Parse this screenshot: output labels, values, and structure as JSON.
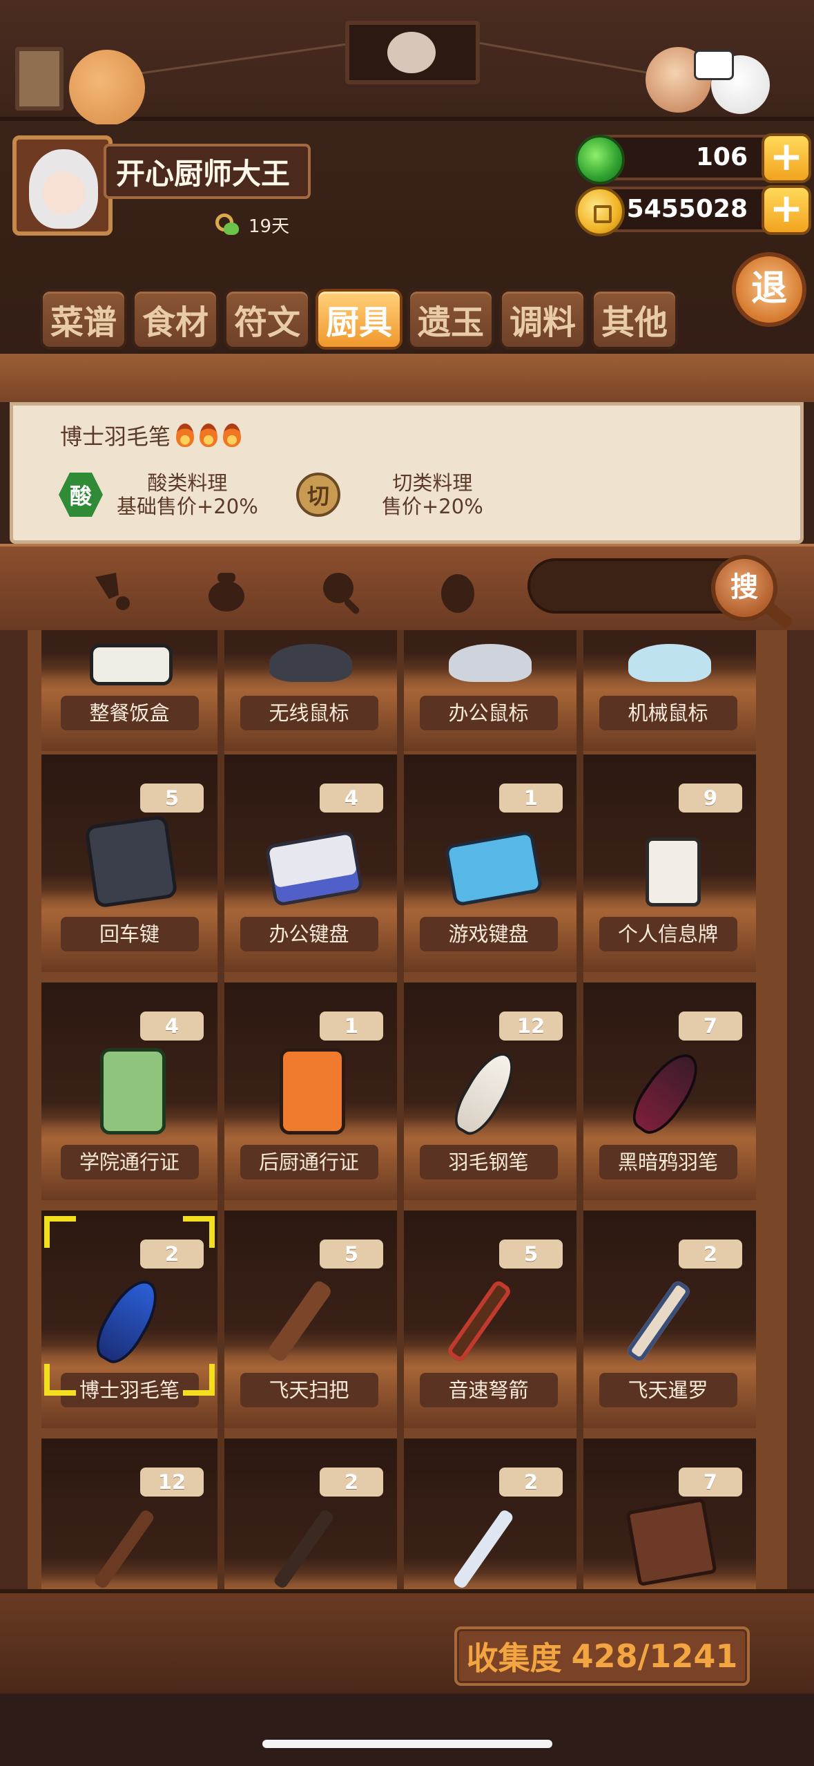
{
  "profile": {
    "name": "开心厨师大王",
    "days": "19天"
  },
  "currency": {
    "jade": "106",
    "coins": "5455028",
    "plus": "+"
  },
  "exit_label": "退",
  "tabs": [
    {
      "label": "菜谱"
    },
    {
      "label": "食材"
    },
    {
      "label": "符文"
    },
    {
      "label": "厨具",
      "active": true
    },
    {
      "label": "遗玉"
    },
    {
      "label": "调料"
    },
    {
      "label": "其他"
    }
  ],
  "detail": {
    "title": "博士羽毛笔",
    "effects": [
      {
        "badge": "酸",
        "line1": "酸类料理",
        "line2": "基础售价+20%"
      },
      {
        "badge": "切",
        "line1": "切类料理",
        "line2": "售价+20%"
      }
    ]
  },
  "search": {
    "button_label": "搜"
  },
  "items": {
    "row0": [
      {
        "label": "整餐饭盒"
      },
      {
        "label": "无线鼠标"
      },
      {
        "label": "办公鼠标"
      },
      {
        "label": "机械鼠标"
      }
    ],
    "row1": [
      {
        "label": "回车键",
        "count": "5",
        "art": "enter-key-icon"
      },
      {
        "label": "办公键盘",
        "count": "4",
        "art": "keyboard-icon"
      },
      {
        "label": "游戏键盘",
        "count": "1",
        "art": "gaming-keyboard-icon"
      },
      {
        "label": "个人信息牌",
        "count": "9",
        "art": "id-tag-icon"
      }
    ],
    "row2": [
      {
        "label": "学院通行证",
        "count": "4",
        "art": "pass-icon"
      },
      {
        "label": "后厨通行证",
        "count": "1",
        "art": "kitchen-pass-icon"
      },
      {
        "label": "羽毛钢笔",
        "count": "12",
        "art": "quill-icon"
      },
      {
        "label": "黑暗鸦羽笔",
        "count": "7",
        "art": "dark-quill-icon"
      }
    ],
    "row3": [
      {
        "label": "博士羽毛笔",
        "count": "2",
        "art": "doctor-quill-icon",
        "selected": true
      },
      {
        "label": "飞天扫把",
        "count": "5",
        "art": "broom-icon"
      },
      {
        "label": "音速弩箭",
        "count": "5",
        "art": "sonic-broom-icon"
      },
      {
        "label": "飞天暹罗",
        "count": "2",
        "art": "siamese-broom-icon"
      }
    ],
    "row4": [
      {
        "count": "12",
        "art": "wand-icon"
      },
      {
        "count": "2",
        "art": "staff-icon"
      },
      {
        "count": "2",
        "art": "crystal-wand-icon"
      },
      {
        "count": "7",
        "art": "book-icon"
      }
    ]
  },
  "collection": {
    "label": "收集度",
    "value": "428/1241"
  },
  "colors": {
    "accent": "#f0982d",
    "selection": "#f2e01e",
    "jade": "#2fa130",
    "coin": "#f0b325"
  }
}
